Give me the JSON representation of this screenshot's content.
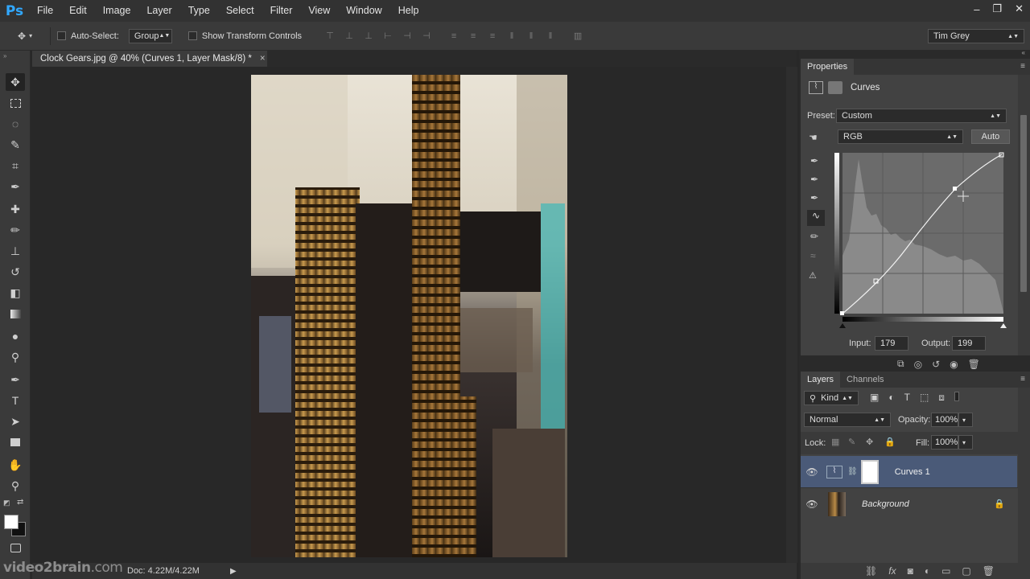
{
  "app": {
    "logo": "Ps"
  },
  "menu": [
    "File",
    "Edit",
    "Image",
    "Layer",
    "Type",
    "Select",
    "Filter",
    "View",
    "Window",
    "Help"
  ],
  "window_controls": {
    "minimize": "–",
    "restore": "❐",
    "close": "✕"
  },
  "options_bar": {
    "auto_select_label": "Auto-Select:",
    "auto_select_target": "Group",
    "show_transform_label": "Show Transform Controls",
    "workspace": "Tim Grey"
  },
  "document": {
    "tab_title": "Clock Gears.jpg @ 40% (Curves 1, Layer Mask/8) *",
    "close": "×",
    "doc_size": "Doc: 4.22M/4.22M"
  },
  "branding": {
    "name": "video2brain",
    "suffix": ".com"
  },
  "properties": {
    "tab": "Properties",
    "title": "Curves",
    "preset_label": "Preset:",
    "preset_value": "Custom",
    "channel": "RGB",
    "auto_label": "Auto",
    "input_label": "Input:",
    "input_value": "179",
    "output_label": "Output:",
    "output_value": "199"
  },
  "layers_panel": {
    "tabs": [
      "Layers",
      "Channels"
    ],
    "filter": "Kind",
    "blend_mode": "Normal",
    "opacity_label": "Opacity:",
    "opacity_value": "100%",
    "lock_label": "Lock:",
    "fill_label": "Fill:",
    "fill_value": "100%",
    "layers": [
      {
        "name": "Curves 1",
        "selected": true
      },
      {
        "name": "Background",
        "selected": false
      }
    ]
  },
  "colors": {
    "accent": "#31a8ff",
    "selected_layer": "#4a5a78",
    "panel": "#424242",
    "canvas": "#282828"
  }
}
